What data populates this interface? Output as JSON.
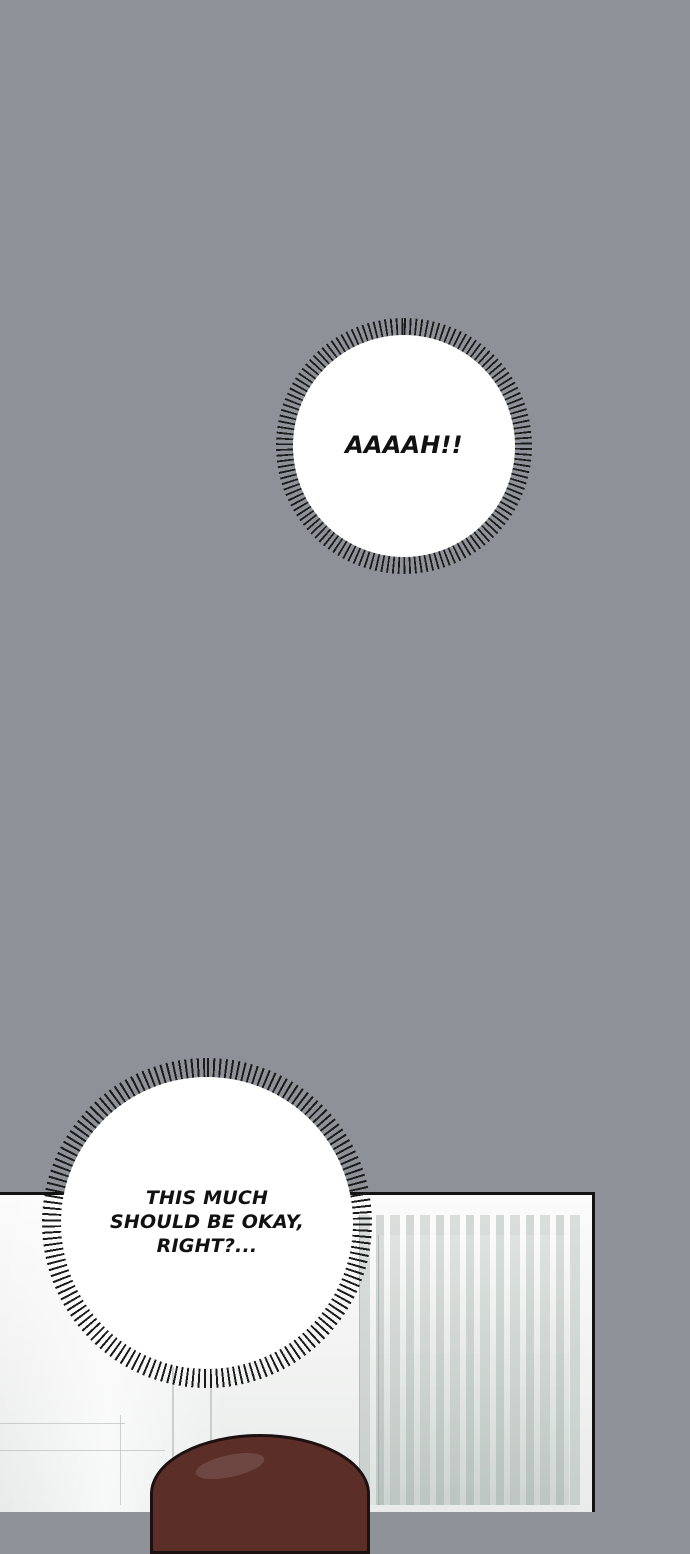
{
  "panel_one": {
    "bubble_text": "AAAAH!!"
  },
  "panel_two": {
    "bubble_text_line_1": "THIS MUCH",
    "bubble_text_line_2": "SHOULD BE OKAY,",
    "bubble_text_line_3": "RIGHT?..."
  },
  "colors": {
    "background": "#8e9198",
    "bubble_fill": "#ffffff",
    "bubble_outline": "#1b1b1b",
    "hair": "#5c2e28"
  },
  "icons": {
    "bubble_style": "burst-speech-bubble"
  }
}
